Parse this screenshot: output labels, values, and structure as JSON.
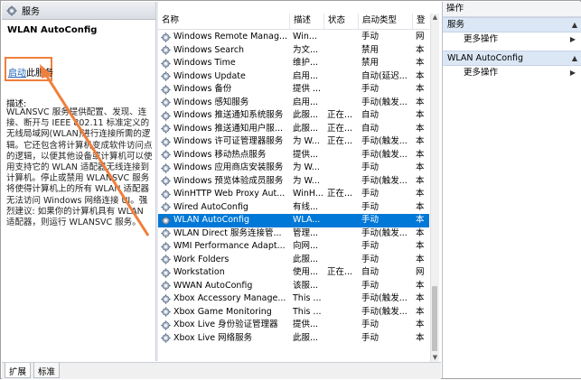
{
  "window": {
    "title": "服务"
  },
  "detail": {
    "service_name": "WLAN AutoConfig",
    "start_link": "启动",
    "start_suffix": "此服务",
    "desc_heading": "描述:",
    "desc_text": "WLANSVC 服务提供配置、发现、连接、断开与 IEEE 802.11 标准定义的无线局域网(WLAN)进行连接所需的逻辑。它还包含将计算机变成软件访问点的逻辑，以便其他设备或计算机可以使用支持它的 WLAN 适配器无线连接到计算机。停止或禁用 WLANSVC 服务将使得计算机上的所有 WLAN 适配器无法访问 Windows 网络连接 UI。强烈建议: 如果你的计算机具有 WLAN 适配器，则运行 WLANSVC 服务。"
  },
  "table": {
    "columns": [
      "名称",
      "描述",
      "状态",
      "启动类型",
      "登"
    ],
    "rows": [
      {
        "name": "Windows Remote Manag...",
        "desc": "Win...",
        "status": "",
        "startup": "手动",
        "logon": "网"
      },
      {
        "name": "Windows Search",
        "desc": "为文...",
        "status": "",
        "startup": "禁用",
        "logon": "本"
      },
      {
        "name": "Windows Time",
        "desc": "维护...",
        "status": "",
        "startup": "禁用",
        "logon": "本"
      },
      {
        "name": "Windows Update",
        "desc": "启用...",
        "status": "",
        "startup": "自动(延迟...",
        "logon": "本"
      },
      {
        "name": "Windows 备份",
        "desc": "提供 ...",
        "status": "",
        "startup": "手动",
        "logon": "本"
      },
      {
        "name": "Windows 感知服务",
        "desc": "启用...",
        "status": "",
        "startup": "手动(触发...",
        "logon": "本"
      },
      {
        "name": "Windows 推送通知系统服务",
        "desc": "此服...",
        "status": "正在...",
        "startup": "自动",
        "logon": "本"
      },
      {
        "name": "Windows 推送通知用户服...",
        "desc": "此服...",
        "status": "正在...",
        "startup": "自动",
        "logon": "本"
      },
      {
        "name": "Windows 许可证管理器服务",
        "desc": "为 W...",
        "status": "正在...",
        "startup": "手动(触发...",
        "logon": "本"
      },
      {
        "name": "Windows 移动热点服务",
        "desc": "提供...",
        "status": "",
        "startup": "手动(触发...",
        "logon": "本"
      },
      {
        "name": "Windows 应用商店安装服务",
        "desc": "为 W...",
        "status": "",
        "startup": "手动",
        "logon": "本"
      },
      {
        "name": "Windows 预览体验成员服务",
        "desc": "为 W...",
        "status": "",
        "startup": "手动(触发...",
        "logon": "本"
      },
      {
        "name": "WinHTTP Web Proxy Aut...",
        "desc": "WinH...",
        "status": "正在...",
        "startup": "手动",
        "logon": "本"
      },
      {
        "name": "Wired AutoConfig",
        "desc": "有线...",
        "status": "",
        "startup": "手动",
        "logon": "本"
      },
      {
        "name": "WLAN AutoConfig",
        "desc": "WLA...",
        "status": "",
        "startup": "手动",
        "logon": "本",
        "selected": true
      },
      {
        "name": "WLAN Direct 服务连接管...",
        "desc": "管理...",
        "status": "",
        "startup": "手动(触发...",
        "logon": "本"
      },
      {
        "name": "WMI Performance Adapt...",
        "desc": "向网...",
        "status": "",
        "startup": "手动",
        "logon": "本"
      },
      {
        "name": "Work Folders",
        "desc": "此服...",
        "status": "",
        "startup": "手动",
        "logon": "本"
      },
      {
        "name": "Workstation",
        "desc": "使用...",
        "status": "正在...",
        "startup": "自动",
        "logon": "网"
      },
      {
        "name": "WWAN AutoConfig",
        "desc": "该服...",
        "status": "",
        "startup": "手动",
        "logon": "本"
      },
      {
        "name": "Xbox Accessory Manage...",
        "desc": "This ...",
        "status": "",
        "startup": "手动(触发...",
        "logon": "本"
      },
      {
        "name": "Xbox Game Monitoring",
        "desc": "This ...",
        "status": "",
        "startup": "手动(触发...",
        "logon": "本"
      },
      {
        "name": "Xbox Live 身份验证管理器",
        "desc": "提供...",
        "status": "",
        "startup": "手动",
        "logon": "本"
      },
      {
        "name": "Xbox Live 网络服务",
        "desc": "此服...",
        "status": "",
        "startup": "手动",
        "logon": "本"
      }
    ]
  },
  "tabs": [
    {
      "label": "扩展"
    },
    {
      "label": "标准"
    }
  ],
  "actions": {
    "header": "操作",
    "sections": [
      {
        "title": "服务",
        "item": "更多操作"
      },
      {
        "title": "WLAN AutoConfig",
        "item": "更多操作"
      }
    ]
  },
  "colors": {
    "selection": "#0078d7",
    "annotation": "#ef7f3c",
    "link": "#1a5fb4"
  },
  "icons": [
    "gear-icon",
    "service-gear-icon",
    "collapse-caret-icon",
    "submenu-arrow-icon"
  ]
}
